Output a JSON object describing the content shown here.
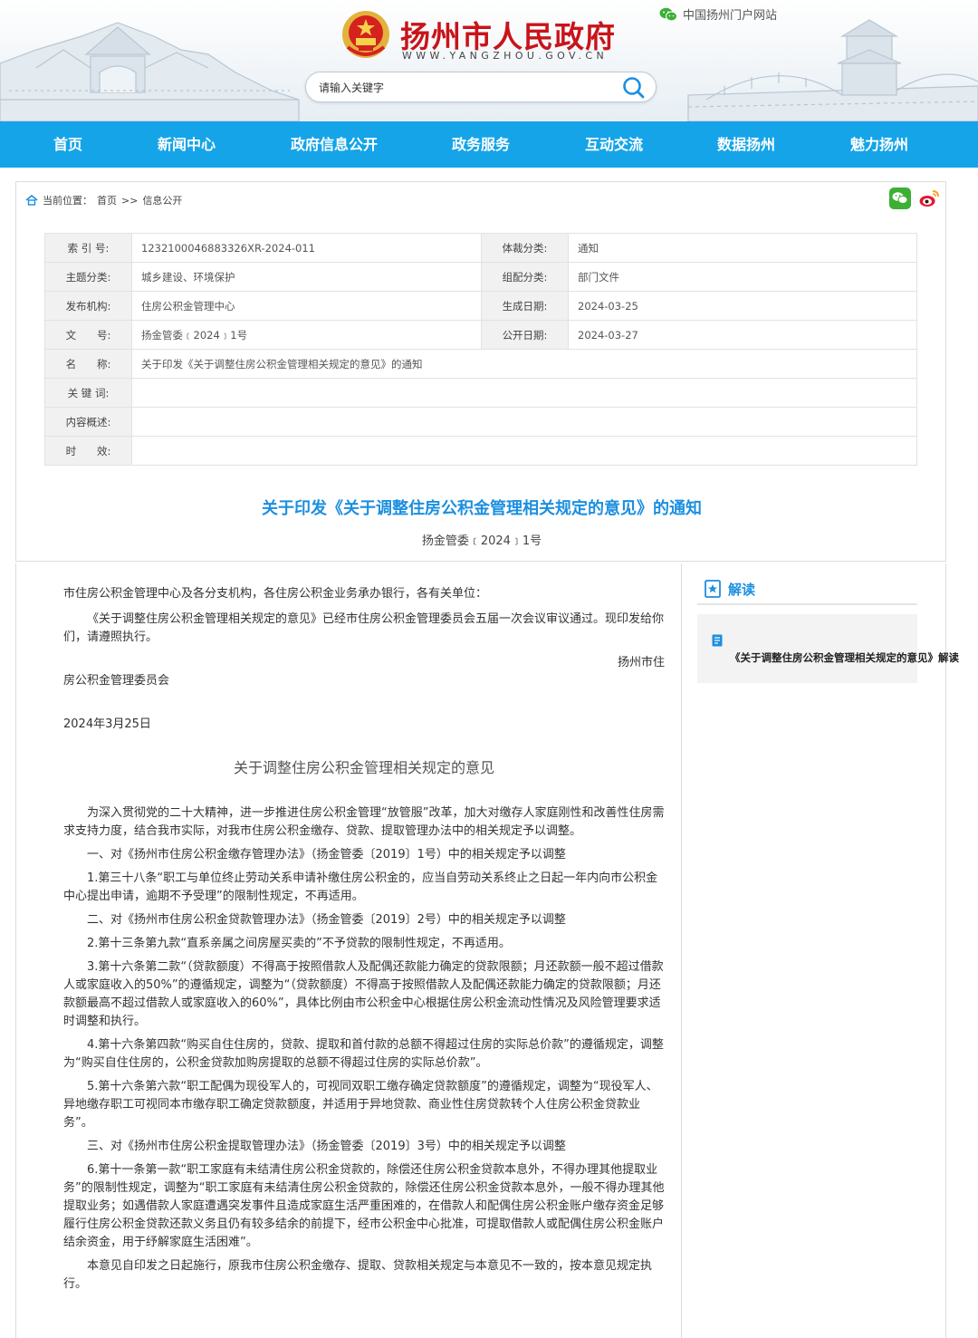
{
  "header": {
    "site_title": "扬州市人民政府",
    "site_domain": "WWW.YANGZHOU.GOV.CN",
    "portal_link": "中国扬州门户网站",
    "search_placeholder": "请输入关键字"
  },
  "nav": [
    "首页",
    "新闻中心",
    "政府信息公开",
    "政务服务",
    "互动交流",
    "数据扬州",
    "魅力扬州"
  ],
  "breadcrumb": {
    "label": "当前位置：",
    "home": "首页",
    "sep": ">>",
    "current": "信息公开"
  },
  "meta": {
    "index_label": "索 引 号:",
    "index_value": "1232100046883326XR-2024-011",
    "genre_label": "体裁分类:",
    "genre_value": "通知",
    "topic_label": "主题分类:",
    "topic_value": "城乡建设、环境保护",
    "org_class_label": "组配分类:",
    "org_class_value": "部门文件",
    "publisher_label": "发布机构:",
    "publisher_value": "住房公积金管理中心",
    "created_label": "生成日期:",
    "created_value": "2024-03-25",
    "docno_label": "文　　号:",
    "docno_value": "扬金管委﹝2024﹞1号",
    "published_label": "公开日期:",
    "published_value": "2024-03-27",
    "name_label": "名　　称:",
    "name_value": "关于印发《关于调整住房公积金管理相关规定的意见》的通知",
    "keywords_label": "关 键 词:",
    "keywords_value": "",
    "summary_label": "内容概述:",
    "summary_value": "",
    "validity_label": "时　　效:",
    "validity_value": ""
  },
  "doc": {
    "title": "关于印发《关于调整住房公积金管理相关规定的意见》的通知",
    "number": "扬金管委﹝2024﹞1号"
  },
  "article": {
    "addressee": "市住房公积金管理中心及各分支机构，各住房公积金业务承办银行，各有关单位：",
    "intro": "《关于调整住房公积金管理相关规定的意见》已经市住房公积金管理委员会五届一次会议审议通过。现印发给你们，请遵照执行。",
    "signer_part1": "扬州市住",
    "signer_part2": "房公积金管理委员会",
    "date": "2024年3月25日",
    "heading": "关于调整住房公积金管理相关规定的意见",
    "paragraphs": [
      "为深入贯彻党的二十大精神，进一步推进住房公积金管理“放管服”改革，加大对缴存人家庭刚性和改善性住房需求支持力度，结合我市实际，对我市住房公积金缴存、贷款、提取管理办法中的相关规定予以调整。",
      "一、对《扬州市住房公积金缴存管理办法》（扬金管委〔2019〕1号）中的相关规定予以调整",
      "1.第三十八条“职工与单位终止劳动关系申请补缴住房公积金的，应当自劳动关系终止之日起一年内向市公积金中心提出申请，逾期不予受理”的限制性规定，不再适用。",
      "二、对《扬州市住房公积金贷款管理办法》（扬金管委〔2019〕2号）中的相关规定予以调整",
      "2.第十三条第九款“直系亲属之间房屋买卖的”不予贷款的限制性规定，不再适用。",
      "3.第十六条第二款“（贷款额度）不得高于按照借款人及配偶还款能力确定的贷款限额；月还款额一般不超过借款人或家庭收入的50%”的遵循规定，调整为“（贷款额度）不得高于按照借款人及配偶还款能力确定的贷款限额；月还款额最高不超过借款人或家庭收入的60%”，具体比例由市公积金中心根据住房公积金流动性情况及风险管理要求适时调整和执行。",
      "4.第十六条第四款“购买自住住房的，贷款、提取和首付款的总额不得超过住房的实际总价款”的遵循规定，调整为“购买自住住房的，公积金贷款加购房提取的总额不得超过住房的实际总价款”。",
      "5.第十六条第六款“职工配偶为现役军人的，可视同双职工缴存确定贷款额度”的遵循规定，调整为“现役军人、异地缴存职工可视同本市缴存职工确定贷款额度，并适用于异地贷款、商业性住房贷款转个人住房公积金贷款业务”。",
      "三、对《扬州市住房公积金提取管理办法》（扬金管委〔2019〕3号）中的相关规定予以调整",
      "6.第十一条第一款“职工家庭有未结清住房公积金贷款的，除偿还住房公积金贷款本息外，不得办理其他提取业务”的限制性规定，调整为“职工家庭有未结清住房公积金贷款的，除偿还住房公积金贷款本息外，一般不得办理其他提取业务；如遇借款人家庭遭遇突发事件且造成家庭生活严重困难的，在借款人和配偶住房公积金账户缴存资金足够履行住房公积金贷款还款义务且仍有较多结余的前提下，经市公积金中心批准，可提取借款人或配偶住房公积金账户结余资金，用于纾解家庭生活困难”。",
      "本意见自印发之日起施行，原我市住房公积金缴存、提取、贷款相关规定与本意见不一致的，按本意见规定执行。"
    ]
  },
  "sidebar": {
    "title": "解读",
    "link": "《关于调整住房公积金管理相关规定的意见》解读"
  },
  "colors": {
    "nav_bg": "#15a4e8",
    "title_red": "#c8141a",
    "accent_blue": "#1c8fe0"
  }
}
